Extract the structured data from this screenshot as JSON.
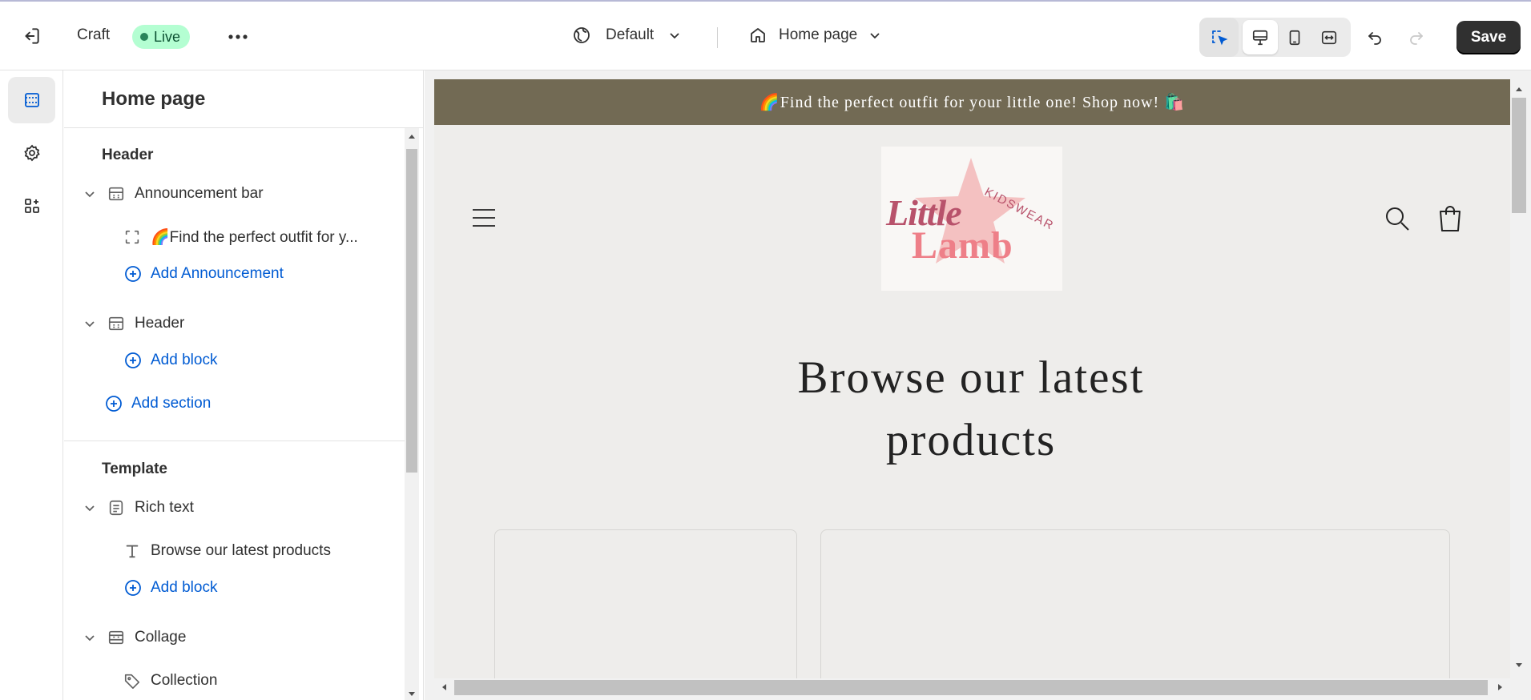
{
  "topbar": {
    "theme_name": "Craft",
    "status": "Live",
    "theme_select": "Default",
    "page_select": "Home page",
    "save_label": "Save"
  },
  "sidebar": {
    "title": "Home page",
    "header_group": "Header",
    "announcement_bar": "Announcement bar",
    "announcement_item": "🌈Find the perfect outfit for y...",
    "add_announcement": "Add Announcement",
    "header_section": "Header",
    "add_block_1": "Add block",
    "add_section": "Add section",
    "template_group": "Template",
    "rich_text": "Rich text",
    "rich_text_item": "Browse our latest products",
    "add_block_2": "Add block",
    "collage": "Collage",
    "collection": "Collection"
  },
  "preview": {
    "announcement": "🌈Find the perfect outfit for your little one! Shop now! 🛍️",
    "logo_word_1": "Little",
    "logo_word_2": "Lamb",
    "logo_word_3": "KIDSWEAR",
    "heading_line_1": "Browse our latest",
    "heading_line_2": "products"
  },
  "colors": {
    "accent_link": "#005bd3",
    "live_badge": "#b4fed2",
    "announcement_bg": "#726a54",
    "save_button": "#303030"
  }
}
